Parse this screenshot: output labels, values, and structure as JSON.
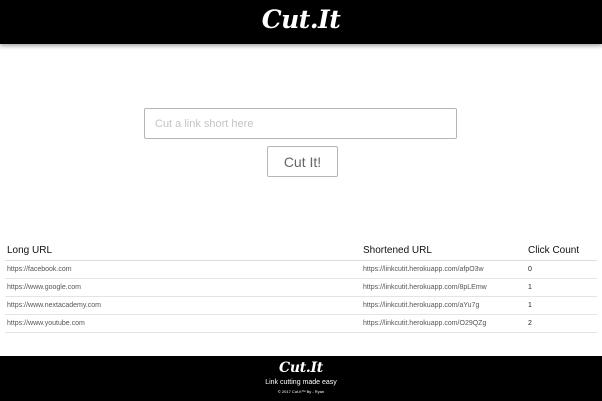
{
  "header": {
    "brand": "Cut.It"
  },
  "form": {
    "input_value": "",
    "input_placeholder": "Cut a link short here",
    "button_label": "Cut It!"
  },
  "table": {
    "headers": [
      "Long URL",
      "Shortened URL",
      "Click Count"
    ],
    "rows": [
      {
        "long_url": "https://facebook.com",
        "short_url": "https://linkcutit.herokuapp.com/afpO3w",
        "clicks": "0"
      },
      {
        "long_url": "https://www.google.com",
        "short_url": "https://linkcutit.herokuapp.com/8pLEmw",
        "clicks": "1"
      },
      {
        "long_url": "https://www.nextacademy.com",
        "short_url": "https://linkcutit.herokuapp.com/aYu7g",
        "clicks": "1"
      },
      {
        "long_url": "https://www.youtube.com",
        "short_url": "https://linkcutit.herokuapp.com/O29QZg",
        "clicks": "2"
      }
    ]
  },
  "footer": {
    "brand": "Cut.It",
    "tagline": "Link cutting made easy",
    "copyright": "© 2017 Cut.It™  By - Ryan"
  }
}
